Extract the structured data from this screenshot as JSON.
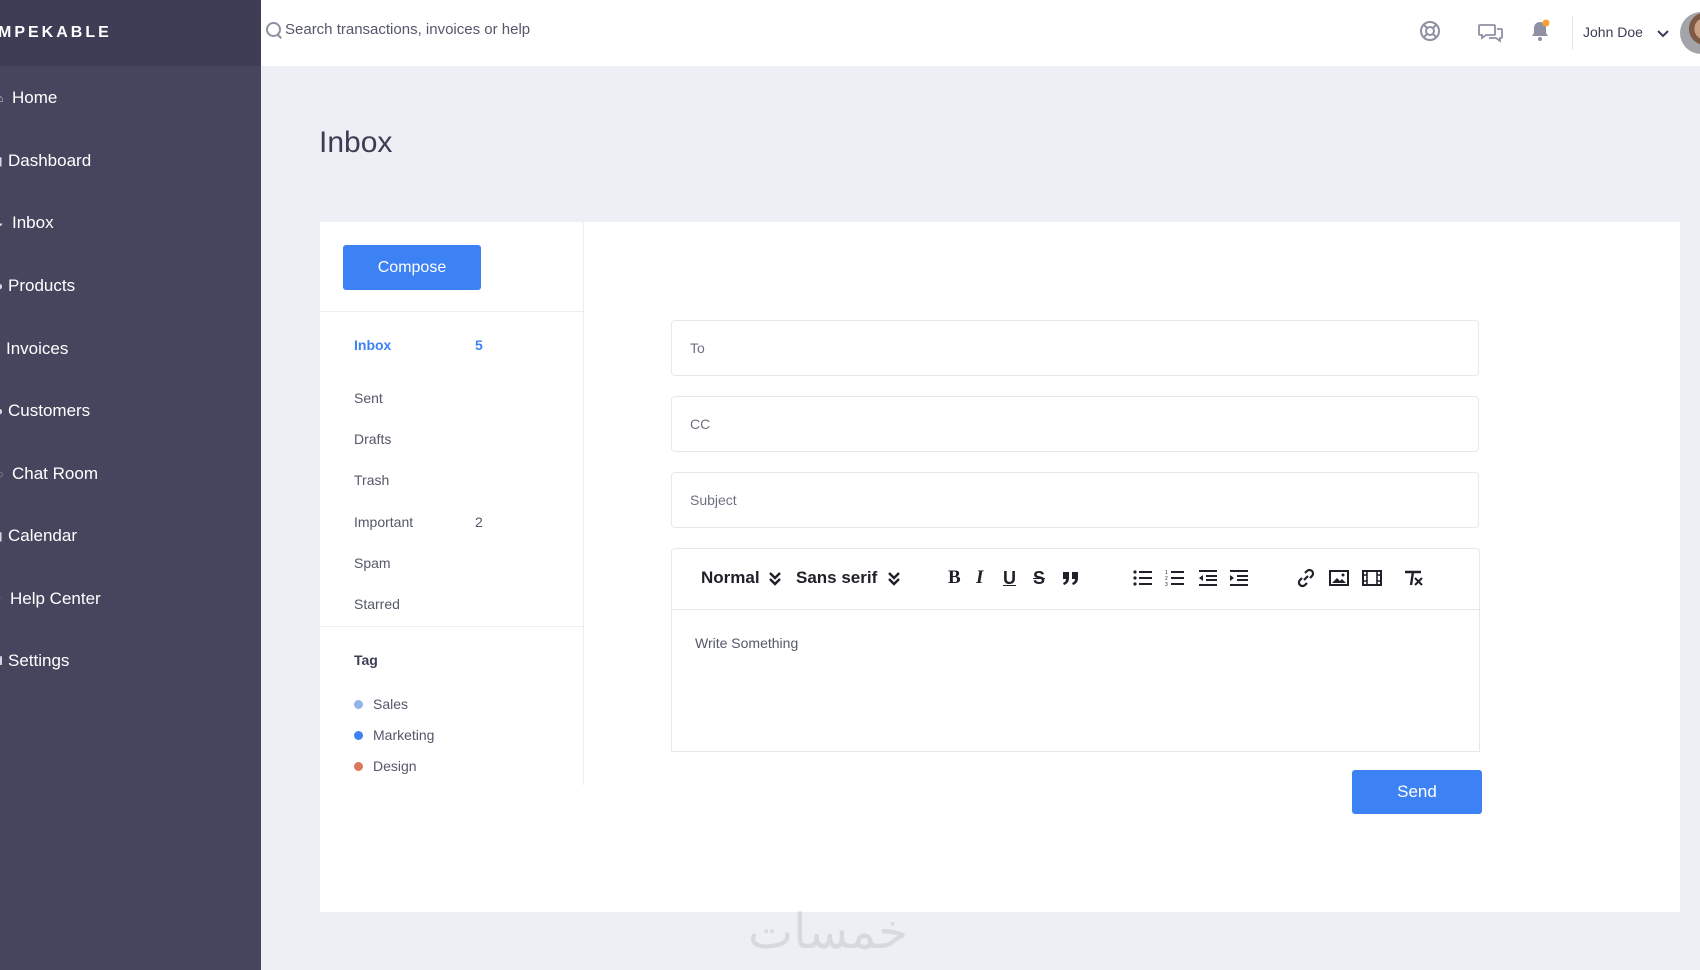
{
  "brand": {
    "name": "MPEKABLE"
  },
  "sidebar": {
    "items": [
      {
        "label": "Home",
        "icon": "home-icon"
      },
      {
        "label": "Dashboard",
        "icon": "chart-icon"
      },
      {
        "label": "Inbox",
        "icon": "inbox-icon"
      },
      {
        "label": "Products",
        "icon": "products-icon"
      },
      {
        "label": "Invoices",
        "icon": "invoice-icon"
      },
      {
        "label": "Customers",
        "icon": "user-icon"
      },
      {
        "label": "Chat Room",
        "icon": "chat-icon"
      },
      {
        "label": "Calendar",
        "icon": "calendar-icon"
      },
      {
        "label": "Help Center",
        "icon": "help-icon"
      },
      {
        "label": "Settings",
        "icon": "gear-icon"
      }
    ]
  },
  "topbar": {
    "search_placeholder": "Search transactions, invoices or help",
    "icons": [
      "lifebuoy-icon",
      "chat-bubbles-icon",
      "bell-icon"
    ],
    "notification_dot_color": "#f7a230",
    "user_name": "John Doe"
  },
  "page": {
    "title": "Inbox"
  },
  "mail": {
    "compose_label": "Compose",
    "folders": [
      {
        "label": "Inbox",
        "count": "5",
        "active": true
      },
      {
        "label": "Sent",
        "count": ""
      },
      {
        "label": "Drafts",
        "count": ""
      },
      {
        "label": "Trash",
        "count": ""
      },
      {
        "label": "Important",
        "count": "2"
      },
      {
        "label": "Spam",
        "count": ""
      },
      {
        "label": "Starred",
        "count": ""
      }
    ],
    "tags_title": "Tag",
    "tags": [
      {
        "label": "Sales",
        "color": "#8fb5ea"
      },
      {
        "label": "Marketing",
        "color": "#3d82f5"
      },
      {
        "label": "Design",
        "color": "#d9795a"
      }
    ]
  },
  "compose_form": {
    "to_placeholder": "To",
    "cc_placeholder": "CC",
    "subject_placeholder": "Subject",
    "format_select": "Normal",
    "font_select": "Sans serif",
    "editor_placeholder": "Write Something",
    "send_label": "Send"
  },
  "colors": {
    "accent": "#3d82f5",
    "sidebar": "#45465e",
    "background": "#eeeff4"
  },
  "watermark": "خمسات"
}
